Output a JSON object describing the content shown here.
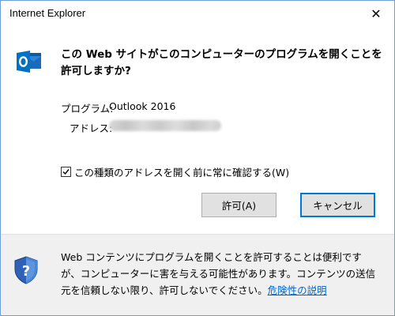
{
  "window": {
    "title": "Internet Explorer",
    "close_glyph": "✕"
  },
  "prompt": {
    "question": "この Web サイトがこのコンピューターのプログラムを開くことを許可しますか?",
    "program_label": "プログラム:",
    "program_value": "Outlook 2016",
    "address_label": "アドレス:",
    "address_value_visible": false
  },
  "checkbox": {
    "checked": true,
    "label": "この種類のアドレスを開く前に常に確認する(W)"
  },
  "buttons": {
    "allow": "許可(A)",
    "cancel": "キャンセル"
  },
  "footer": {
    "text": "Web コンテンツにプログラムを開くことを許可することは便利ですが、コンピューターに害を与える可能性があります。コンテンツの送信元を信頼しない限り、許可しないでください。",
    "link": "危険性の説明"
  },
  "icons": {
    "app": "outlook-icon",
    "footer": "security-shield-icon",
    "close": "close-icon",
    "check": "checkmark-icon"
  },
  "colors": {
    "accent": "#0078d7",
    "link": "#0066cc",
    "outlook_blue": "#0072c6",
    "footer_bg": "#f0f0f0"
  }
}
